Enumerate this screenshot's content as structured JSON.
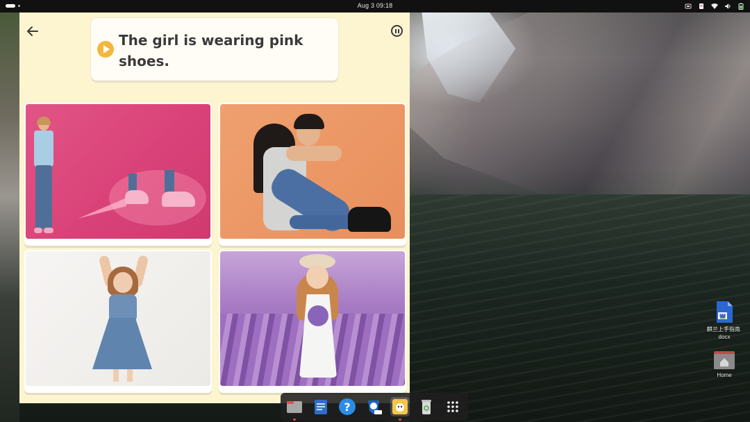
{
  "topbar": {
    "clock": "Aug 3  09:18",
    "tray_icons": [
      "screen-icon",
      "clipboard-icon",
      "network-icon",
      "volume-icon",
      "battery-icon"
    ]
  },
  "app": {
    "background_color": "#fdf4d0",
    "prompt": "The girl is wearing pink shoes.",
    "accent_color": "#f4b73e",
    "options": [
      {
        "description_icon": "photo-girl-pink-shoes-icon",
        "background": "#dc4a7e"
      },
      {
        "description_icon": "photo-girl-black-shoes-icon",
        "background": "#eb9765"
      },
      {
        "description_icon": "photo-girl-denim-dress-icon",
        "background": "#f1f0ed"
      },
      {
        "description_icon": "photo-girl-lavender-field-icon",
        "background": "#a77bc4"
      }
    ]
  },
  "dock": {
    "items": [
      {
        "icon": "files-icon",
        "running": true
      },
      {
        "icon": "notes-icon",
        "running": false
      },
      {
        "icon": "help-icon",
        "running": false
      },
      {
        "icon": "browser-beta-icon",
        "running": false
      },
      {
        "icon": "learning-app-icon",
        "running": true,
        "active": true
      },
      {
        "icon": "trash-icon",
        "running": false
      },
      {
        "icon": "app-grid-icon",
        "running": false
      }
    ]
  },
  "desktop": {
    "icons": [
      {
        "icon": "word-document-icon",
        "label_line1": "麒兰上手指南.",
        "label_line2": "docx"
      },
      {
        "icon": "home-folder-icon",
        "label_line1": "Home",
        "label_line2": ""
      }
    ]
  }
}
